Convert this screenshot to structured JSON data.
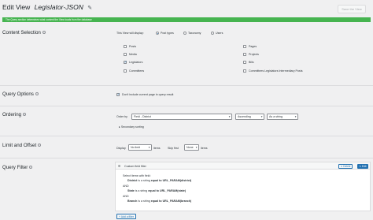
{
  "header": {
    "title": "Edit View",
    "view_name": "Legislator-JSON",
    "save_label": "Save the View"
  },
  "notice": "The Query section determines what content the View loads from the database",
  "content_selection": {
    "label": "Content Selection",
    "prompt": "This View will display:",
    "modes": [
      {
        "label": "Post types",
        "checked": true
      },
      {
        "label": "Taxonomy",
        "checked": false
      },
      {
        "label": "Users",
        "checked": false
      }
    ],
    "post_types_left": [
      {
        "label": "Posts",
        "checked": false
      },
      {
        "label": "Media",
        "checked": false
      },
      {
        "label": "Legislators",
        "checked": true
      },
      {
        "label": "Committees",
        "checked": false
      }
    ],
    "post_types_right": [
      {
        "label": "Pages",
        "checked": false
      },
      {
        "label": "Projects",
        "checked": false
      },
      {
        "label": "Bills",
        "checked": false
      },
      {
        "label": "Committees Legislators Intermediary Posts",
        "checked": false
      }
    ]
  },
  "query_options": {
    "label": "Query Options",
    "option_label": "Don't include current page in query result",
    "checked": true
  },
  "ordering": {
    "label": "Ordering",
    "order_by_label": "Order by",
    "order_by_value": "Field - District",
    "direction_value": "Ascending",
    "type_value": "As a string",
    "secondary_label": "Secondary sorting"
  },
  "limit_offset": {
    "label": "Limit and Offset",
    "display_label": "Display",
    "display_value": "No limit",
    "items_label": "items",
    "skip_label": "Skip first",
    "skip_value": "None",
    "items_label_2": "items"
  },
  "query_filter": {
    "label": "Query Filter",
    "box_title": "Custom field filter",
    "delete_label": "Delete",
    "edit_label": "Edit",
    "intro": "Select items with field:",
    "conditions": [
      {
        "field": "District",
        "text": "is a string",
        "op": "equal to",
        "value": "URL_PARAM(district)"
      },
      {
        "field": "State",
        "text": "is a string",
        "op": "equal to",
        "value": "URL_PARAM(state)"
      },
      {
        "field": "Branch",
        "text": "is a string",
        "op": "equal to",
        "value": "URL_PARAM(branch)"
      }
    ],
    "and_label": "AND",
    "add_filter_label": "Add a filter"
  }
}
